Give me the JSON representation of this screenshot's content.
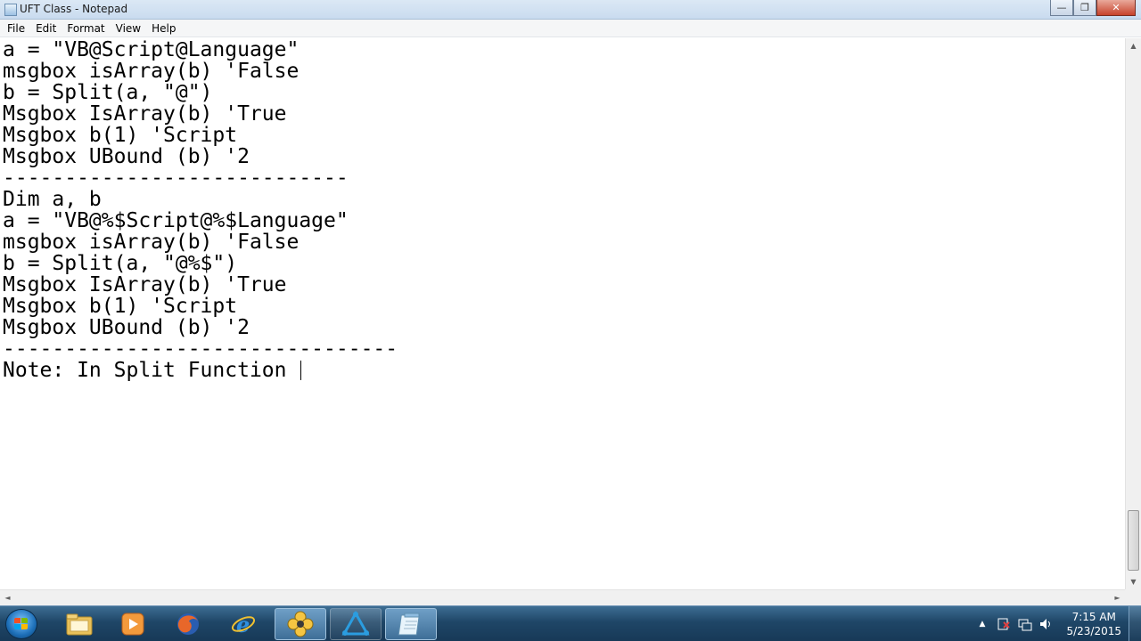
{
  "window": {
    "title": "UFT Class - Notepad",
    "minimize": "—",
    "maximize": "❐",
    "close": "✕"
  },
  "menu": [
    "File",
    "Edit",
    "Format",
    "View",
    "Help"
  ],
  "editor": {
    "lines": [
      "a = \"VB@Script@Language\"",
      "msgbox isArray(b) 'False",
      "b = Split(a, \"@\")",
      "Msgbox IsArray(b) 'True",
      "Msgbox b(1) 'Script",
      "Msgbox UBound (b) '2",
      "----------------------------",
      "Dim a, b",
      "a = \"VB@%$Script@%$Language\"",
      "msgbox isArray(b) 'False",
      "b = Split(a, \"@%$\")",
      "Msgbox IsArray(b) 'True",
      "Msgbox b(1) 'Script",
      "Msgbox UBound (b) '2",
      "--------------------------------",
      "Note: In Split Function "
    ]
  },
  "scrollbars": {
    "up_arrow": "▲",
    "down_arrow": "▼",
    "left_arrow": "◄",
    "right_arrow": "►"
  },
  "taskbar": {
    "pinned": [
      {
        "name": "windows-explorer-icon",
        "active": false
      },
      {
        "name": "media-player-icon",
        "active": false
      },
      {
        "name": "firefox-icon",
        "active": false
      },
      {
        "name": "internet-explorer-icon",
        "active": false
      },
      {
        "name": "app-flower-icon",
        "active": true
      },
      {
        "name": "app-triangle-icon",
        "active": true
      },
      {
        "name": "notepad-icon",
        "active": true
      }
    ],
    "clock_time": "7:15 AM",
    "clock_date": "5/23/2015"
  },
  "colors": {
    "taskbar": "#1f4667",
    "editor_bg": "#ffffff",
    "text": "#000000"
  }
}
